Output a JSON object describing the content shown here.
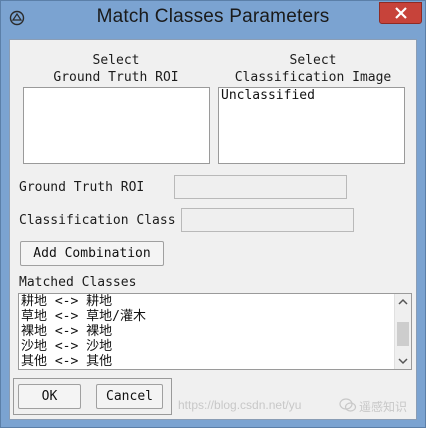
{
  "window": {
    "title": "Match Classes Parameters",
    "icons": [
      "app-icon",
      "close-icon"
    ],
    "accent": "#7ba3d1"
  },
  "ground_truth_roi_list": {
    "header_line1": "Select",
    "header_line2": "Ground Truth ROI",
    "items": []
  },
  "classification_image_list": {
    "header_line1": "Select",
    "header_line2": "Classification Image",
    "items": [
      "Unclassified"
    ]
  },
  "fields": {
    "ground_truth_roi_label": "Ground Truth ROI",
    "ground_truth_roi_value": "",
    "classification_class_label": "Classification Class",
    "classification_class_value": ""
  },
  "buttons": {
    "add_combination": "Add Combination",
    "ok": "OK",
    "cancel": "Cancel"
  },
  "matched_classes": {
    "label": "Matched Classes",
    "items": [
      "耕地 <-> 耕地",
      "草地 <-> 草地/灌木",
      "裸地 <-> 裸地",
      "沙地 <-> 沙地",
      "其他 <-> 其他"
    ]
  },
  "watermark": {
    "url": "https://blog.csdn.net/yu",
    "brand": "遥感知识"
  }
}
